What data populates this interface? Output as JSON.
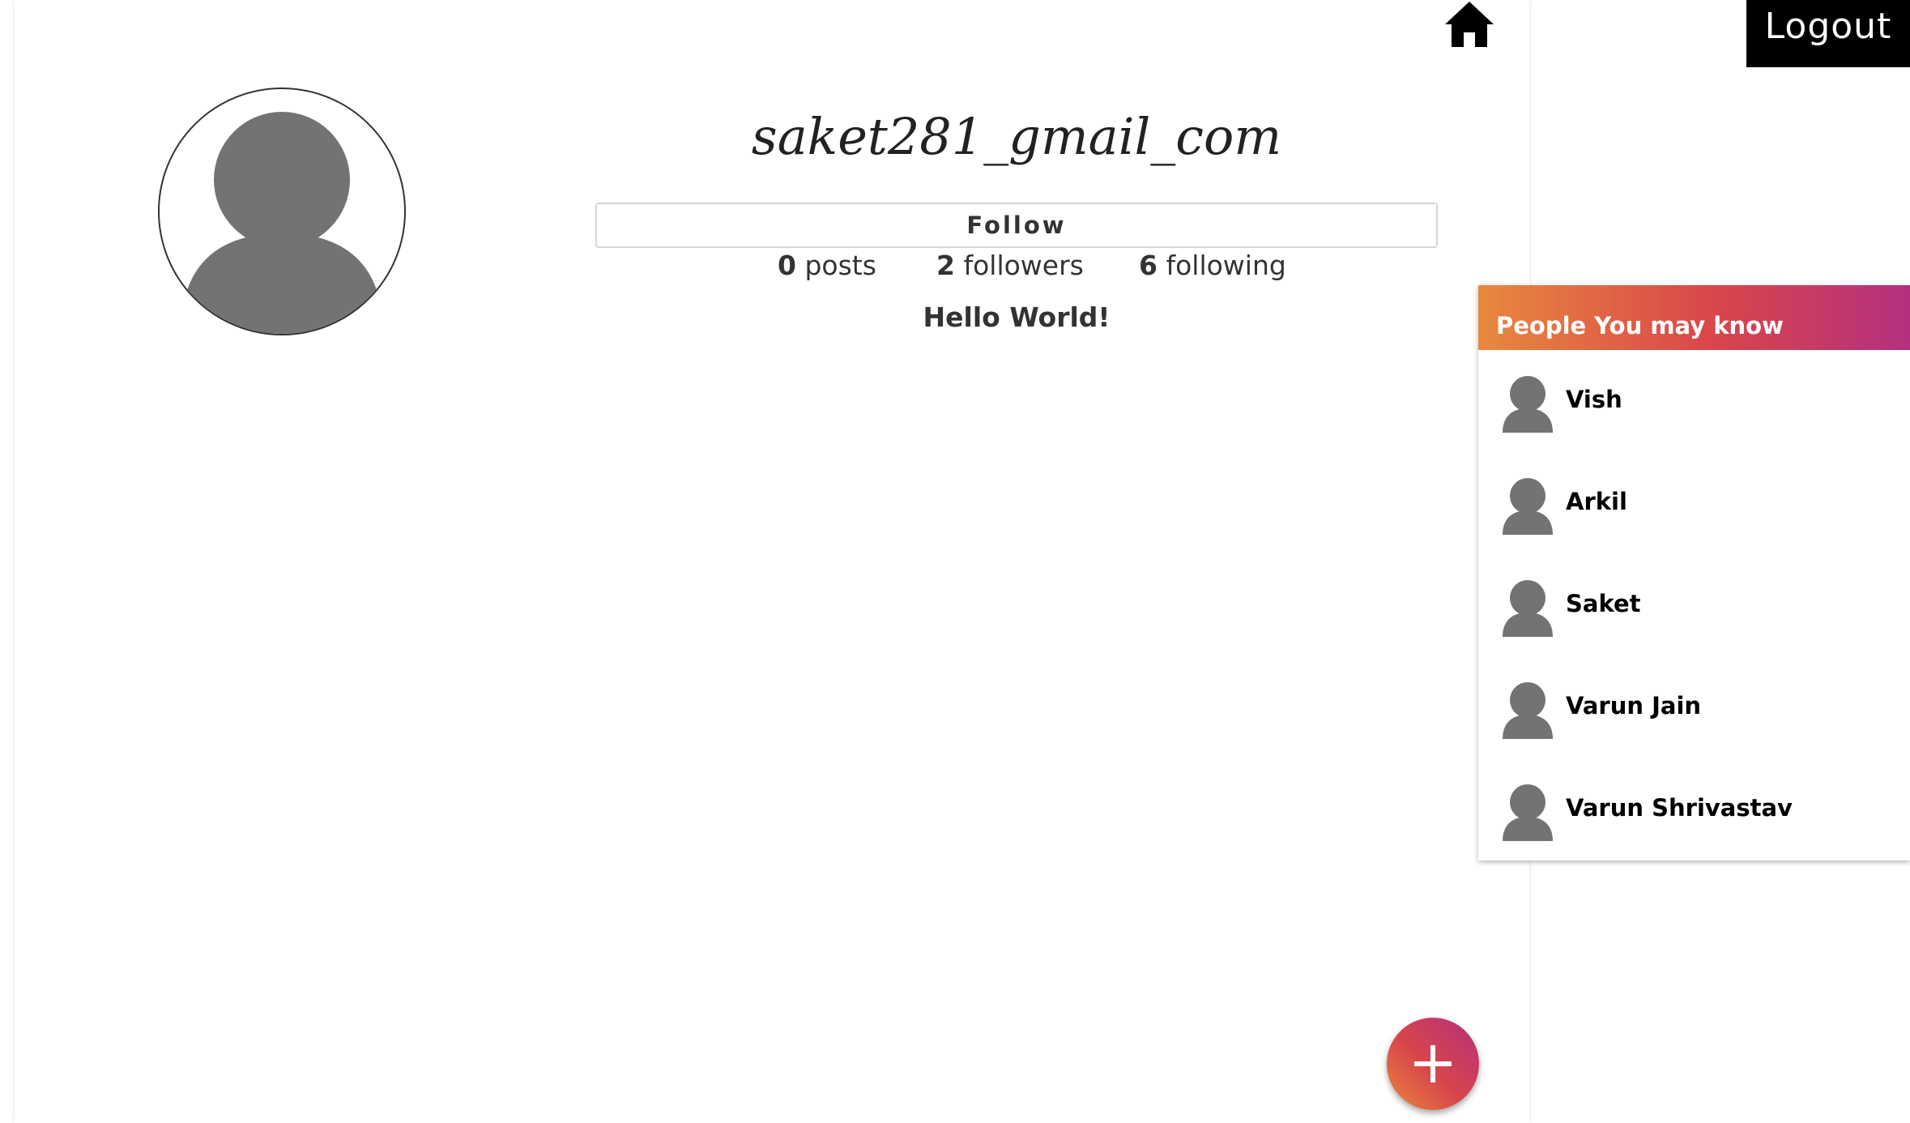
{
  "header": {
    "logout_label": "Logout",
    "home_icon": "home-icon"
  },
  "profile": {
    "username": "saket281_gmail_com",
    "follow_label": "Follow",
    "posts_count": "0",
    "posts_label": "posts",
    "followers_count": "2",
    "followers_label": "followers",
    "following_count": "6",
    "following_label": "following",
    "bio": "Hello World!",
    "avatar_icon": "user-silhouette-icon"
  },
  "suggestions": {
    "title": "People You may know",
    "items": [
      {
        "name": "Vish"
      },
      {
        "name": "Arkil"
      },
      {
        "name": "Saket"
      },
      {
        "name": "Varun Jain"
      },
      {
        "name": "Varun Shrivastav"
      }
    ]
  },
  "fab": {
    "icon": "plus-icon"
  },
  "colors": {
    "gradient_start": "#e8893f",
    "gradient_mid": "#d9454b",
    "gradient_end": "#b3307e",
    "avatar_gray": "#737373"
  }
}
